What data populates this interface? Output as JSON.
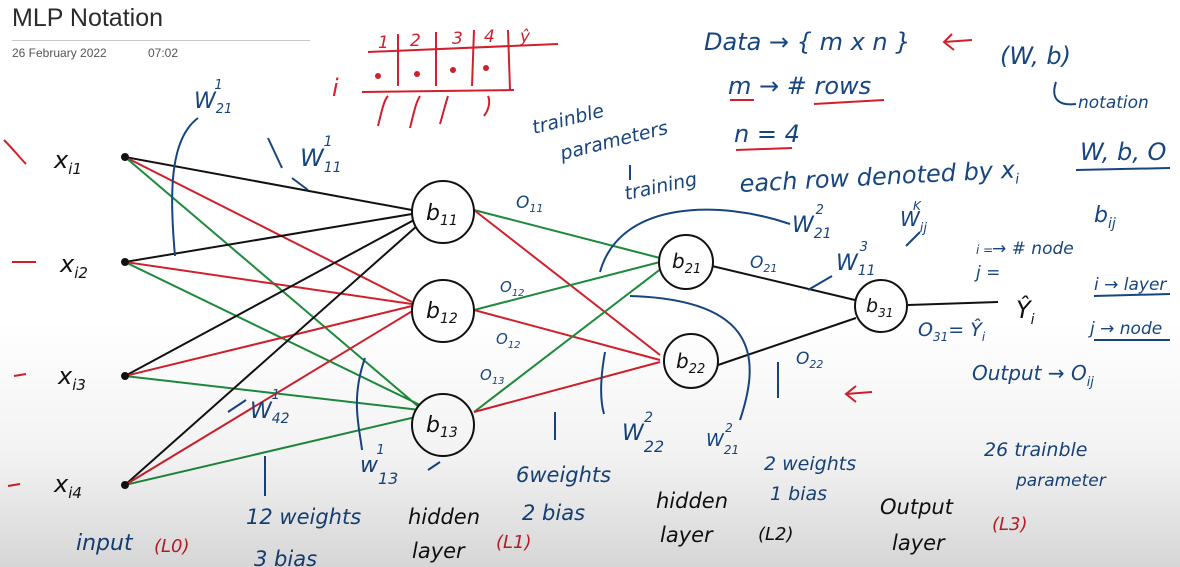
{
  "page": {
    "title": "MLP Notation",
    "date": "26 February 2022",
    "time": "07:02"
  },
  "colors": {
    "ink_blue": "#17457f",
    "ink_red": "#d0202c",
    "ink_green": "#1e8a3c",
    "ink_black": "#111111"
  },
  "network": {
    "inputs": [
      "x",
      "x",
      "x",
      "x"
    ],
    "input_subscripts": [
      "i1",
      "i2",
      "i3",
      "i4"
    ],
    "layer1_nodes": [
      "b",
      "b",
      "b"
    ],
    "layer1_subscripts": [
      "11",
      "12",
      "13"
    ],
    "layer2_nodes": [
      "b",
      "b"
    ],
    "layer2_subscripts": [
      "21",
      "22"
    ],
    "output_node": "b",
    "output_subscript": "31",
    "output_y": "Ŷ",
    "output_y_sub": "i"
  },
  "annotations": {
    "w21_1": "W",
    "w21_1_sub": "21",
    "w21_1_sup": "1",
    "w11_1": "W",
    "w11_1_sub": "11",
    "w11_1_sup": "1",
    "w42_1": "W",
    "w42_1_sub": "42",
    "w42_1_sup": "1",
    "w13_1": "w",
    "w13_1_sub": "13",
    "w13_1_sup": "1",
    "w21_2_top": "W",
    "w21_2_top_sub": "21",
    "w21_2_top_sup": "2",
    "w22_2": "W",
    "w22_2_sub": "22",
    "w22_2_sup": "2",
    "w21_2_bot": "W",
    "w21_2_bot_sub": "21",
    "w21_2_bot_sup": "2",
    "w11_3": "W",
    "w11_3_sub": "11",
    "w11_3_sup": "3",
    "wjk": "W",
    "wjk_sub": "ij",
    "wjk_sup": "K",
    "o11": "O",
    "o11_sub": "11",
    "o12": "O",
    "o12_sub": "12",
    "o13": "O",
    "o13_sub": "13",
    "o21": "O",
    "o21_sub": "21",
    "o22": "O",
    "o22_sub": "22",
    "o31": "O",
    "o31_sub": "31",
    "o31_eq": "= Ŷ",
    "o31_eq_sub": "i",
    "trainable_1": "trainble",
    "trainable_2": "parameters",
    "training": "training",
    "each_row": "each row denoted by x",
    "each_row_sub": "i",
    "data": "Data → { m x n }",
    "m_rows": "m → # rows",
    "n_eq": "n = 4",
    "wb": "(W, b)",
    "notation": "notation",
    "wbo": "W, b, O",
    "bij": "b",
    "bij_sub": "ij",
    "node_note": "→ # node",
    "i_eq": "i =",
    "j_eq": "j =",
    "i_layer": "i → layer",
    "j_node": "j → node",
    "output_note": "Output → O",
    "output_note_sub": "ij",
    "weights_12": "12 weights",
    "bias_3": "3 bias",
    "weights_6": "6weights",
    "bias_2": "2 bias",
    "weights_2": "2 weights",
    "bias_1": "1 bias",
    "trainable_26_1": "26 trainble",
    "trainable_26_2": "parameter",
    "input_label": "input",
    "l0": "(L0)",
    "hidden_1a": "hidden",
    "hidden_1b": "layer",
    "l1": "(L1)",
    "hidden_2a": "hidden",
    "hidden_2b": "layer",
    "l2": "(L2)",
    "output_a": "Output",
    "output_b": "layer",
    "l3": "(L3)",
    "table_headers": [
      "1",
      "2",
      "3",
      "4",
      "ŷ"
    ],
    "table_i": "i"
  }
}
